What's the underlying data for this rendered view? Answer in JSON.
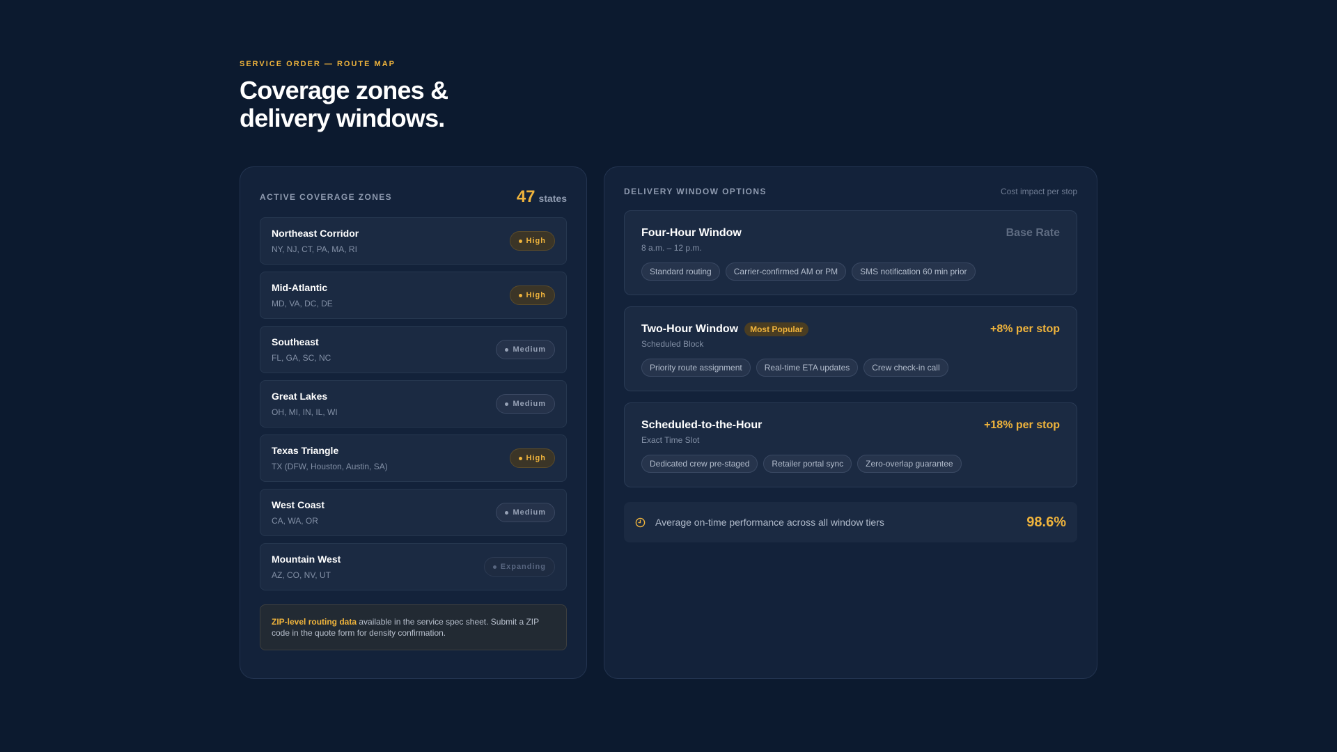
{
  "header": {
    "eyebrow": "SERVICE ORDER — ROUTE MAP",
    "title": "Coverage zones & delivery windows."
  },
  "zones_panel": {
    "label": "ACTIVE COVERAGE ZONES",
    "states_count": "47",
    "states_unit": "states",
    "zones": [
      {
        "name": "Northeast Corridor",
        "states": "NY, NJ, CT, PA, MA, RI",
        "density": "High"
      },
      {
        "name": "Mid-Atlantic",
        "states": "MD, VA, DC, DE",
        "density": "High"
      },
      {
        "name": "Southeast",
        "states": "FL, GA, SC, NC",
        "density": "Medium"
      },
      {
        "name": "Great Lakes",
        "states": "OH, MI, IN, IL, WI",
        "density": "Medium"
      },
      {
        "name": "Texas Triangle",
        "states": "TX (DFW, Houston, Austin, SA)",
        "density": "High"
      },
      {
        "name": "West Coast",
        "states": "CA, WA, OR",
        "density": "Medium"
      },
      {
        "name": "Mountain West",
        "states": "AZ, CO, NV, UT",
        "density": "Expanding"
      }
    ],
    "note_strong": "ZIP-level routing data",
    "note_text": " available in the service spec sheet. Submit a ZIP code in the quote form for density confirmation."
  },
  "windows_panel": {
    "label": "DELIVERY WINDOW OPTIONS",
    "cost_note": "Cost impact per stop",
    "tiers": [
      {
        "title": "Four-Hour Window",
        "badge": "",
        "price": "Base Rate",
        "sub": "8 a.m. – 12 p.m.",
        "features": [
          "Standard routing",
          "Carrier-confirmed AM or PM",
          "SMS notification 60 min prior"
        ]
      },
      {
        "title": "Two-Hour Window",
        "badge": "Most Popular",
        "price": "+8% per stop",
        "sub": "Scheduled Block",
        "features": [
          "Priority route assignment",
          "Real-time ETA updates",
          "Crew check-in call"
        ]
      },
      {
        "title": "Scheduled-to-the-Hour",
        "badge": "",
        "price": "+18% per stop",
        "sub": "Exact Time Slot",
        "features": [
          "Dedicated crew pre-staged",
          "Retailer portal sync",
          "Zero-overlap guarantee"
        ]
      }
    ],
    "performance": {
      "text": "Average on-time performance across all window tiers",
      "value": "98.6%",
      "icon": "clock-icon"
    }
  },
  "colors": {
    "accent": "#f0b43c",
    "background": "#0c1a2f",
    "panel": "#13223a"
  }
}
